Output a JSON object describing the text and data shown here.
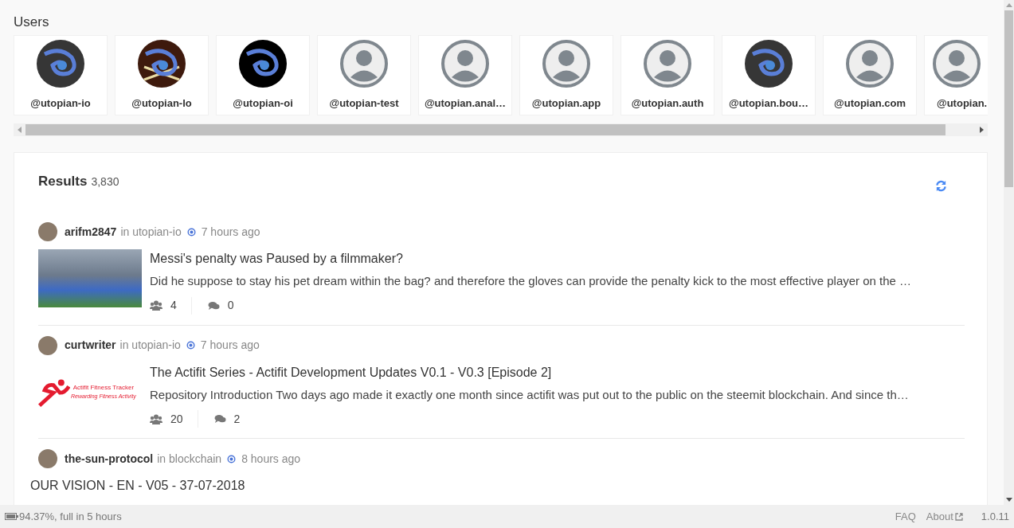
{
  "users_title": "Users",
  "users": [
    {
      "name": "@utopian-io",
      "kind": "dark"
    },
    {
      "name": "@utopian-lo",
      "kind": "pirate"
    },
    {
      "name": "@utopian-oi",
      "kind": "black"
    },
    {
      "name": "@utopian-test",
      "kind": "default"
    },
    {
      "name": "@utopian.anal…",
      "kind": "default"
    },
    {
      "name": "@utopian.app",
      "kind": "default"
    },
    {
      "name": "@utopian.auth",
      "kind": "default"
    },
    {
      "name": "@utopian.bou…",
      "kind": "dark"
    },
    {
      "name": "@utopian.com",
      "kind": "default"
    },
    {
      "name": "@utopian.",
      "kind": "default"
    }
  ],
  "results": {
    "title": "Results",
    "count": "3,830"
  },
  "posts": [
    {
      "author": "arifm2847",
      "in": "in",
      "category": "utopian-io",
      "time": "7 hours ago",
      "thumbnail": {
        "kind": "photo"
      },
      "title": "Messi's penalty was Paused by a filmmaker?",
      "excerpt": "Did he suppose to stay his pet dream within the bag? and therefore the gloves can provide the penalty kick to the most effective player on the …",
      "votes": "4",
      "comments": "0"
    },
    {
      "author": "curtwriter",
      "in": "in",
      "category": "utopian-io",
      "time": "7 hours ago",
      "thumbnail": {
        "kind": "logo",
        "text": "Actifit Fitness Tracker",
        "subtext": "Rewarding Fitness Activity"
      },
      "title": "The Actifit Series - Actifit Development Updates V0.1 - V0.3 [Episode 2]",
      "excerpt": "Repository Introduction Two days ago made it exactly one month since actifit was put out to the public on the steemit blockchain. And since th…",
      "votes": "20",
      "comments": "2"
    },
    {
      "author": "the-sun-protocol",
      "in": "in",
      "category": "blockchain",
      "time": "8 hours ago",
      "title": "OUR VISION - EN - V05 - 37-07-2018"
    }
  ],
  "status_bar": {
    "battery": "94.37%, full in 5 hours",
    "links": [
      {
        "label": "FAQ",
        "external": false
      },
      {
        "label": "About",
        "external": true
      }
    ],
    "version": "1.0.11"
  }
}
